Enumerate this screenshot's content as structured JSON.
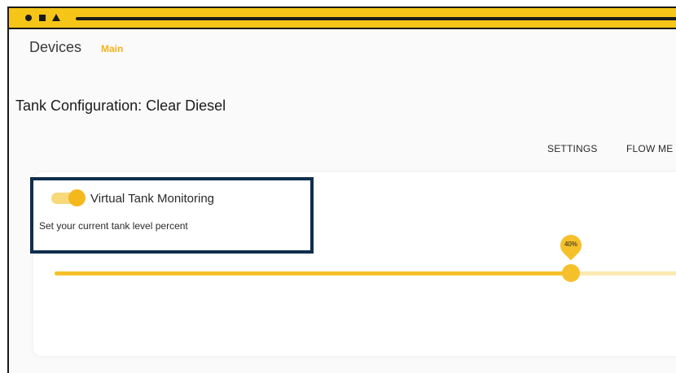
{
  "window": {
    "controls": [
      "circle-icon",
      "square-icon",
      "triangle-icon"
    ],
    "accent_color": "#f5c518",
    "border_color": "#1a1a1a"
  },
  "breadcrumb": {
    "title": "Devices",
    "sub": "Main"
  },
  "page": {
    "title": "Tank Configuration: Clear Diesel"
  },
  "tabs": [
    {
      "label": "SETTINGS"
    },
    {
      "label": "FLOW ME"
    }
  ],
  "virtual_tank": {
    "toggle_on": true,
    "label": "Virtual Tank Monitoring",
    "description": "Set your current tank level percent",
    "highlight_color": "#0f2e4e"
  },
  "slider": {
    "value_percent": 40,
    "tooltip": "40%",
    "fill_color": "#f5c02a",
    "track_color": "#fbe9b3"
  }
}
